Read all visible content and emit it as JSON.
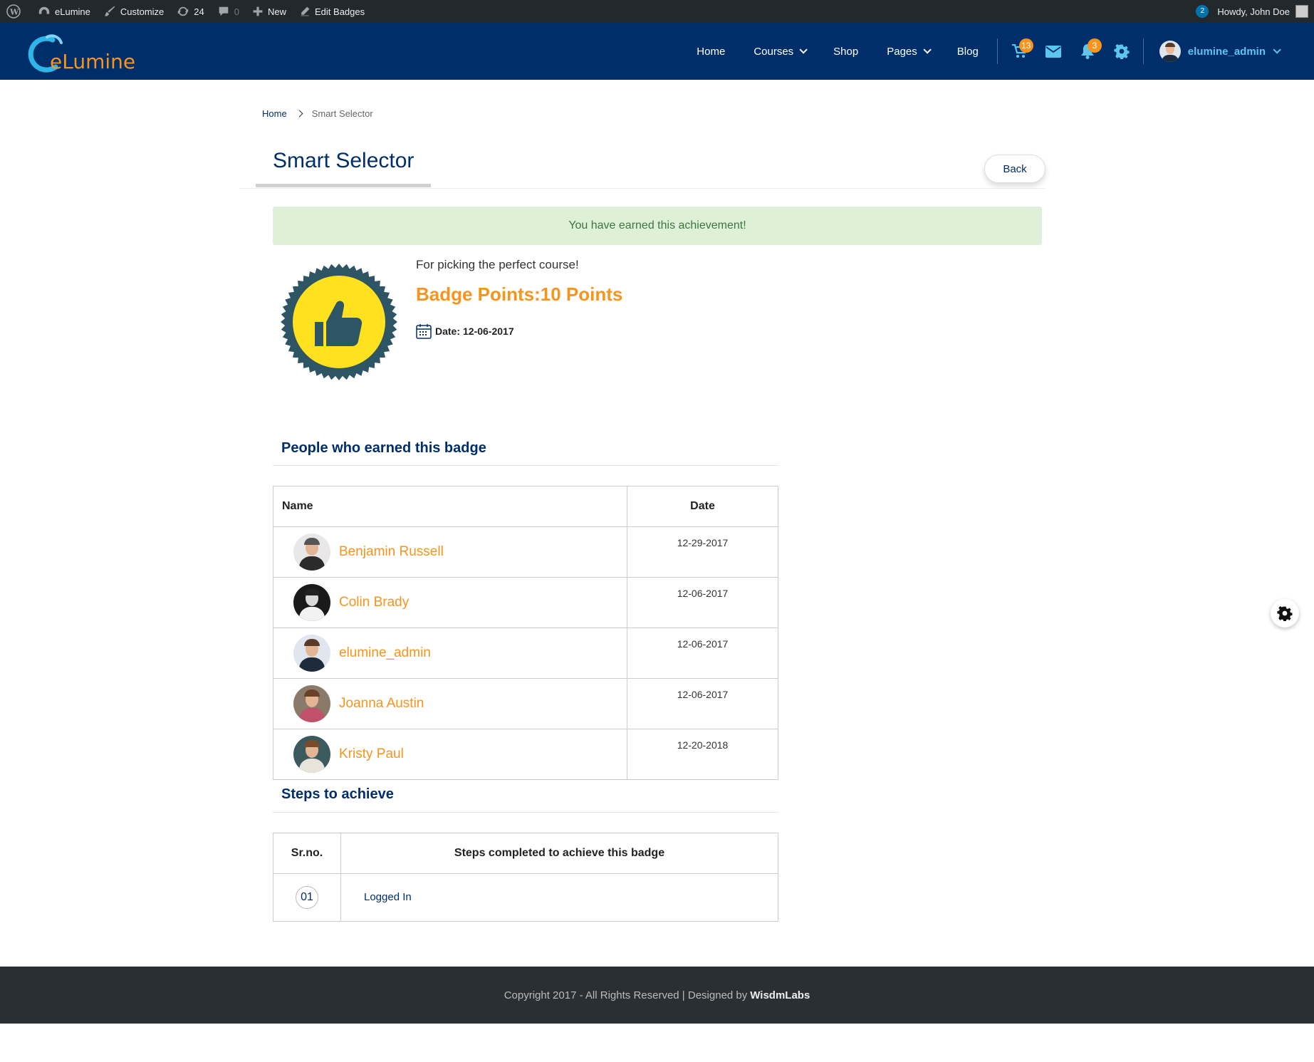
{
  "adminbar": {
    "site_name": "eLumine",
    "customize": "Customize",
    "updates_count": "24",
    "comments_count": "0",
    "new_label": "New",
    "edit_label": "Edit Badges",
    "notif_count": "2",
    "howdy": "Howdy, John Doe"
  },
  "nav": {
    "logo_text": "eLumine",
    "items": [
      {
        "label": "Home"
      },
      {
        "label": "Courses"
      },
      {
        "label": "Shop"
      },
      {
        "label": "Pages"
      },
      {
        "label": "Blog"
      }
    ],
    "cart_count": "13",
    "bell_count": "3",
    "username": "elumine_admin"
  },
  "breadcrumb": {
    "home": "Home",
    "current": "Smart Selector"
  },
  "page": {
    "title": "Smart Selector",
    "back_label": "Back",
    "alert": "You have earned this achievement!"
  },
  "badge": {
    "description": "For picking the perfect course!",
    "points": "Badge Points:10 Points",
    "date_label": "Date:",
    "date_value": "12-06-2017",
    "colors": {
      "ring": "#2d5563",
      "fill": "#ffe11f",
      "thumb": "#2d5563"
    }
  },
  "people": {
    "heading": "People who earned this badge",
    "col_name": "Name",
    "col_date": "Date",
    "rows": [
      {
        "name": "Benjamin Russell",
        "date": "12-29-2017"
      },
      {
        "name": "Colin Brady",
        "date": "12-06-2017"
      },
      {
        "name": "elumine_admin",
        "date": "12-06-2017"
      },
      {
        "name": "Joanna Austin",
        "date": "12-06-2017"
      },
      {
        "name": "Kristy Paul",
        "date": "12-20-2018"
      }
    ]
  },
  "steps": {
    "heading": "Steps to achieve",
    "col_sr": "Sr.no.",
    "col_steps": "Steps completed to achieve this badge",
    "rows": [
      {
        "sr": "01",
        "step": "Logged In"
      }
    ]
  },
  "footer": {
    "text": "Copyright 2017 - All Rights Reserved | Designed by",
    "brand": "WisdmLabs"
  },
  "theme": {
    "nav_bg": "#002e6b",
    "accent": "#f7941d",
    "link": "#5cc5f0",
    "footer_bg": "#2a2f33"
  }
}
